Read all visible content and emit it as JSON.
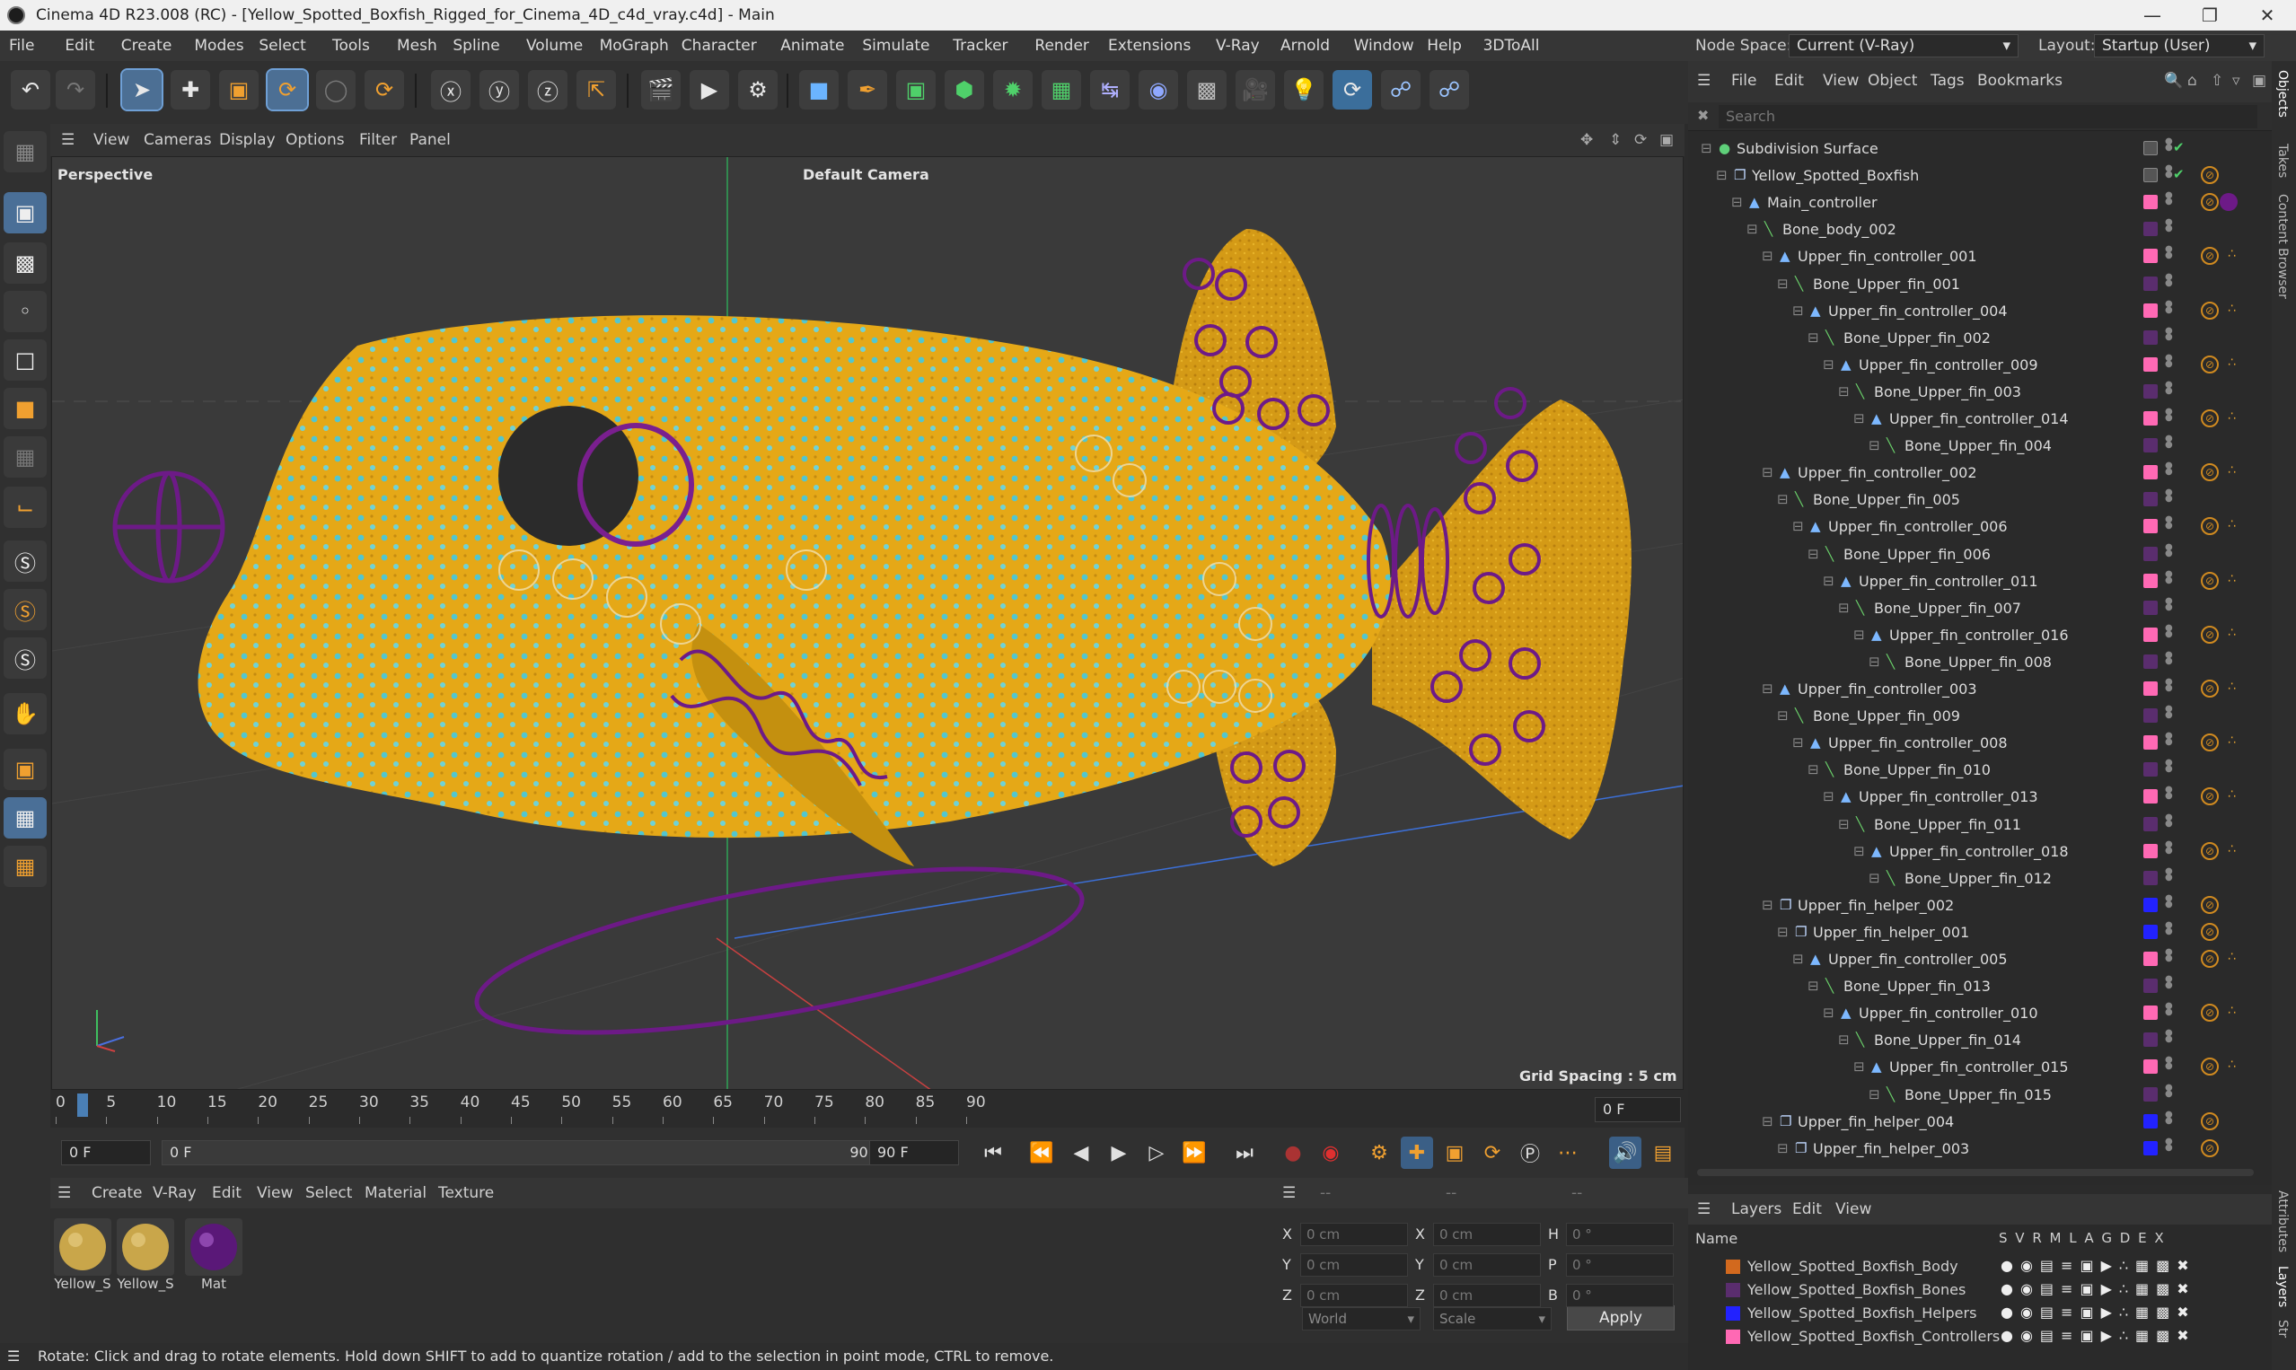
{
  "window": {
    "title": "Cinema 4D R23.008 (RC) - [Yellow_Spotted_Boxfish_Rigged_for_Cinema_4D_c4d_vray.c4d] - Main"
  },
  "menu": [
    "File",
    "Edit",
    "Create",
    "Modes",
    "Select",
    "Tools",
    "Mesh",
    "Spline",
    "Volume",
    "MoGraph",
    "Character",
    "Animate",
    "Simulate",
    "Tracker",
    "Render",
    "Extensions",
    "V-Ray",
    "Arnold",
    "Window",
    "Help",
    "3DToAll"
  ],
  "nodespace": {
    "label": "Node Space:",
    "value": "Current (V-Ray)",
    "layout_label": "Layout:",
    "layout_value": "Startup (User)"
  },
  "viewport": {
    "menu": [
      "View",
      "Cameras",
      "Display",
      "Options",
      "Filter",
      "Panel"
    ],
    "view_name": "Perspective",
    "camera": "Default Camera",
    "grid_spacing": "Grid Spacing : 5 cm"
  },
  "timeline": {
    "ticks": [
      "0",
      "5",
      "10",
      "15",
      "20",
      "25",
      "30",
      "35",
      "40",
      "45",
      "50",
      "55",
      "60",
      "65",
      "70",
      "75",
      "80",
      "85",
      "90"
    ],
    "current_frame_right": "0 F",
    "start_frame": "0 F",
    "range_start": "0 F",
    "range_end": "90 F",
    "end_frame": "90 F"
  },
  "materials": {
    "menu": [
      "Create",
      "V-Ray",
      "Edit",
      "View",
      "Select",
      "Material",
      "Texture"
    ],
    "items": [
      {
        "label": "Yellow_S"
      },
      {
        "label": "Yellow_S"
      },
      {
        "label": "Mat"
      }
    ]
  },
  "attributes": {
    "header_a": "--",
    "header_b": "--",
    "header_c": "--",
    "rows": [
      {
        "l1": "X",
        "v1": "0 cm",
        "l2": "X",
        "v2": "0 cm",
        "l3": "H",
        "v3": "0 °"
      },
      {
        "l1": "Y",
        "v1": "0 cm",
        "l2": "Y",
        "v2": "0 cm",
        "l3": "P",
        "v3": "0 °"
      },
      {
        "l1": "Z",
        "v1": "0 cm",
        "l2": "Z",
        "v2": "0 cm",
        "l3": "B",
        "v3": "0 °"
      }
    ],
    "coord_mode": "World",
    "size_mode": "Scale",
    "apply": "Apply"
  },
  "status": "Rotate: Click and drag to rotate elements. Hold down SHIFT to add to quantize rotation / add to the selection in point mode, CTRL to remove.",
  "objects": {
    "menu": [
      "File",
      "Edit",
      "View",
      "Object",
      "Tags",
      "Bookmarks"
    ],
    "search_placeholder": "Search",
    "tree": [
      {
        "name": "Subdivision Surface",
        "depth": 0,
        "icon": "sub",
        "layer": ""
      },
      {
        "name": "Yellow_Spotted_Boxfish",
        "depth": 1,
        "icon": "obj",
        "layer": ""
      },
      {
        "name": "Main_controller",
        "depth": 2,
        "icon": "null",
        "layer": "#ff69b4"
      },
      {
        "name": "Bone_body_002",
        "depth": 3,
        "icon": "bone",
        "layer": "#5a2d6e"
      },
      {
        "name": "Upper_fin_controller_001",
        "depth": 4,
        "icon": "null",
        "layer": "#ff69b4"
      },
      {
        "name": "Bone_Upper_fin_001",
        "depth": 5,
        "icon": "bone",
        "layer": "#5a2d6e"
      },
      {
        "name": "Upper_fin_controller_004",
        "depth": 6,
        "icon": "null",
        "layer": "#ff69b4"
      },
      {
        "name": "Bone_Upper_fin_002",
        "depth": 7,
        "icon": "bone",
        "layer": "#5a2d6e"
      },
      {
        "name": "Upper_fin_controller_009",
        "depth": 8,
        "icon": "null",
        "layer": "#ff69b4"
      },
      {
        "name": "Bone_Upper_fin_003",
        "depth": 9,
        "icon": "bone",
        "layer": "#5a2d6e"
      },
      {
        "name": "Upper_fin_controller_014",
        "depth": 10,
        "icon": "null",
        "layer": "#ff69b4"
      },
      {
        "name": "Bone_Upper_fin_004",
        "depth": 11,
        "icon": "bone",
        "layer": "#5a2d6e"
      },
      {
        "name": "Upper_fin_controller_002",
        "depth": 4,
        "icon": "null",
        "layer": "#ff69b4"
      },
      {
        "name": "Bone_Upper_fin_005",
        "depth": 5,
        "icon": "bone",
        "layer": "#5a2d6e"
      },
      {
        "name": "Upper_fin_controller_006",
        "depth": 6,
        "icon": "null",
        "layer": "#ff69b4"
      },
      {
        "name": "Bone_Upper_fin_006",
        "depth": 7,
        "icon": "bone",
        "layer": "#5a2d6e"
      },
      {
        "name": "Upper_fin_controller_011",
        "depth": 8,
        "icon": "null",
        "layer": "#ff69b4"
      },
      {
        "name": "Bone_Upper_fin_007",
        "depth": 9,
        "icon": "bone",
        "layer": "#5a2d6e"
      },
      {
        "name": "Upper_fin_controller_016",
        "depth": 10,
        "icon": "null",
        "layer": "#ff69b4"
      },
      {
        "name": "Bone_Upper_fin_008",
        "depth": 11,
        "icon": "bone",
        "layer": "#5a2d6e"
      },
      {
        "name": "Upper_fin_controller_003",
        "depth": 4,
        "icon": "null",
        "layer": "#ff69b4"
      },
      {
        "name": "Bone_Upper_fin_009",
        "depth": 5,
        "icon": "bone",
        "layer": "#5a2d6e"
      },
      {
        "name": "Upper_fin_controller_008",
        "depth": 6,
        "icon": "null",
        "layer": "#ff69b4"
      },
      {
        "name": "Bone_Upper_fin_010",
        "depth": 7,
        "icon": "bone",
        "layer": "#5a2d6e"
      },
      {
        "name": "Upper_fin_controller_013",
        "depth": 8,
        "icon": "null",
        "layer": "#ff69b4"
      },
      {
        "name": "Bone_Upper_fin_011",
        "depth": 9,
        "icon": "bone",
        "layer": "#5a2d6e"
      },
      {
        "name": "Upper_fin_controller_018",
        "depth": 10,
        "icon": "null",
        "layer": "#ff69b4"
      },
      {
        "name": "Bone_Upper_fin_012",
        "depth": 11,
        "icon": "bone",
        "layer": "#5a2d6e"
      },
      {
        "name": "Upper_fin_helper_002",
        "depth": 4,
        "icon": "obj",
        "layer": "#2222ff"
      },
      {
        "name": "Upper_fin_helper_001",
        "depth": 5,
        "icon": "obj",
        "layer": "#2222ff"
      },
      {
        "name": "Upper_fin_controller_005",
        "depth": 6,
        "icon": "null",
        "layer": "#ff69b4"
      },
      {
        "name": "Bone_Upper_fin_013",
        "depth": 7,
        "icon": "bone",
        "layer": "#5a2d6e"
      },
      {
        "name": "Upper_fin_controller_010",
        "depth": 8,
        "icon": "null",
        "layer": "#ff69b4"
      },
      {
        "name": "Bone_Upper_fin_014",
        "depth": 9,
        "icon": "bone",
        "layer": "#5a2d6e"
      },
      {
        "name": "Upper_fin_controller_015",
        "depth": 10,
        "icon": "null",
        "layer": "#ff69b4"
      },
      {
        "name": "Bone_Upper_fin_015",
        "depth": 11,
        "icon": "bone",
        "layer": "#5a2d6e"
      },
      {
        "name": "Upper_fin_helper_004",
        "depth": 4,
        "icon": "obj",
        "layer": "#2222ff"
      },
      {
        "name": "Upper_fin_helper_003",
        "depth": 5,
        "icon": "obj",
        "layer": "#2222ff"
      }
    ]
  },
  "layers": {
    "menu": [
      "Layers",
      "Edit",
      "View"
    ],
    "header_name": "Name",
    "header_flags": "S V R M L A G D E X",
    "items": [
      {
        "name": "Yellow_Spotted_Boxfish_Body",
        "color": "#d2691e"
      },
      {
        "name": "Yellow_Spotted_Boxfish_Bones",
        "color": "#5a2d6e"
      },
      {
        "name": "Yellow_Spotted_Boxfish_Helpers",
        "color": "#2222ff"
      },
      {
        "name": "Yellow_Spotted_Boxfish_Controllers",
        "color": "#ff69b4"
      }
    ]
  },
  "side_tabs": [
    "Objects",
    "Takes",
    "Content Browser",
    "Attributes",
    "Layers",
    "Str"
  ]
}
